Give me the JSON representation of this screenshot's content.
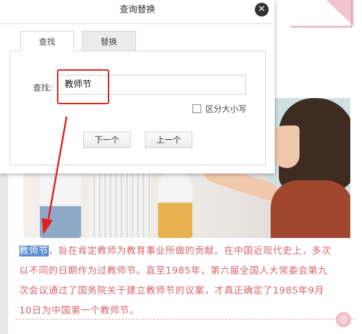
{
  "dialog": {
    "title": "查询替换",
    "close_icon": "close-icon",
    "tabs": [
      {
        "label": "查找",
        "active": true
      },
      {
        "label": "替换",
        "active": false
      }
    ],
    "find_label": "查找:",
    "find_value": "教师节",
    "case_sensitive_label": "区分大小写",
    "case_sensitive_checked": false,
    "next_button": "下一个",
    "prev_button": "上一个"
  },
  "article": {
    "highlight": "教师节",
    "rest": "，旨在肯定教师为教育事业所做的贡献。在中国近现代史上，多次以不同的日期作为过教师节。直至1985年，第六届全国人大常委会第九次会议通过了国务院关于建立教师节的议案，才真正确定了1985年9月10日为中国第一个教师节。"
  },
  "colors": {
    "article_text": "#d4646e",
    "highlight_bg": "#5b8fd1",
    "annotation": "#e02020",
    "accent_pink": "#e4a7b6"
  }
}
